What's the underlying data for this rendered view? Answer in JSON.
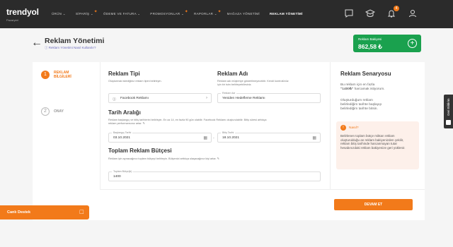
{
  "brand": {
    "name": "trendyol",
    "sub": "Pazaryeri"
  },
  "nav": {
    "items": [
      {
        "label": "ÜRÜN ⌄",
        "pin": false
      },
      {
        "label": "SİPARİŞ ⌄",
        "pin": true
      },
      {
        "label": "ÖDEME VE FATURA ⌄",
        "pin": false
      },
      {
        "label": "PROMOSYONLAR ⌄",
        "pin": true
      },
      {
        "label": "RAPORLAR ⌄",
        "pin": true
      },
      {
        "label": "MAĞAZA YÖNETİMİ",
        "pin": false
      },
      {
        "label": "REKLAM YÖNETİMİ",
        "pin": false,
        "active": true
      }
    ],
    "notification_count": "4"
  },
  "header": {
    "title": "Reklam Yönetimi",
    "help": "Reklam Yönetimi Nasıl Kullanılır?",
    "balance_label": "Reklam Bakiyesi",
    "balance_value": "862,58 ₺"
  },
  "steps": [
    {
      "num": "1",
      "label_line1": "REKLAM",
      "label_line2": "BİLGİLERİ",
      "active": true
    },
    {
      "num": "2",
      "label_line1": "ONAY",
      "label_line2": "",
      "active": false
    }
  ],
  "ad_type": {
    "title": "Reklam Tipi",
    "desc": "Oluşturmak istediğiniz reklam tipini belirleyin.",
    "value": "Facebook Reklamı"
  },
  "ad_name": {
    "title": "Reklam Adı",
    "desc_line1": "Reklam adı müşteriye gösterilmeyecektir. Kendi kontrolünüz",
    "desc_line2": "için bir isim belirleyebilirsiniz.",
    "field_label": "Reklam Adı",
    "value": "Yeniden Hedefleme Reklamı"
  },
  "date_range": {
    "title": "Tarih Aralığı",
    "desc_line1": "Reklam başlangıç ve bitiş tarihlerini belirleyin. En az 14, en fazla 90 gün olabilir. Facebook Reklamı oluşturulabilir. Bitiş süresi arttıkça",
    "desc_line2": "reklam performansınız artar.",
    "start_label": "Başlangıç Tarihi",
    "start_value": "03.10.2021",
    "end_label": "Bitiş Tarihi",
    "end_value": "18.10.2021"
  },
  "budget": {
    "title": "Toplam Reklam Bütçesi",
    "desc": "Reklam için ayıracağınız toplam bütçeyi belirleyin. Bütçenizi arttıkça ulaşacağınız kişi artar.",
    "field_label": "Toplam Bütçe(₺)",
    "value": "1400"
  },
  "scenario": {
    "title": "Reklam Senaryosu",
    "p1_line1": "Bu reklam için en fazla",
    "p1_line2a": "\"1400₺\"",
    "p1_line2b": " harcamak istiyorum.",
    "p2_line1": "Oluşturduğum reklam",
    "p2_line2": "belirlediğim tarihte başlayıp",
    "p2_line3": "belirlediğim tarihte bitsin.",
    "info_head": "Nasıl?",
    "info_text": "Belirlenen toplam bütçe miktarı reklam oluşturulduğu an reklam bakiyenizden çekilir, reklam bitiş tarihinde harcanmayan tutar hesabınızdaki reklam bakiyenize geri yüklenir."
  },
  "actions": {
    "continue": "DEVAM ET"
  },
  "live_support": {
    "label": "Canlı Destek"
  },
  "side_tab": {
    "label": "Geri Bildirim"
  },
  "colors": {
    "accent": "#f27a1a",
    "nav_bg": "#2b2b2b",
    "balance_bg": "#1aa14e"
  }
}
